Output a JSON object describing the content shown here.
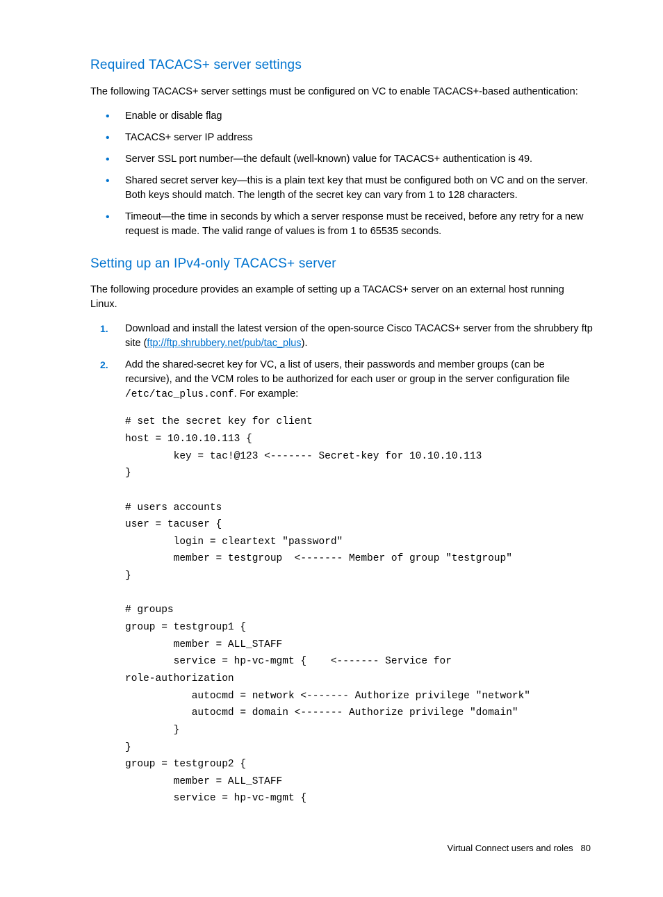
{
  "sections": {
    "required": {
      "title": "Required TACACS+ server settings",
      "intro": "The following TACACS+ server settings must be configured on VC to enable TACACS+-based authentication:",
      "bullets": [
        "Enable or disable flag",
        "TACACS+ server IP address",
        "Server SSL port number—the default (well-known) value for TACACS+ authentication is 49.",
        "Shared secret server key—this is a plain text key that must be configured both on VC and on the server. Both keys should match. The length of the secret key can vary from 1 to 128 characters.",
        "Timeout—the time in seconds by which a server response must be received, before any retry for a new request is made. The valid range of values is from 1 to 65535 seconds."
      ]
    },
    "setup": {
      "title": "Setting up an IPv4-only TACACS+ server",
      "intro": "The following procedure provides an example of setting up a TACACS+ server on an external host running Linux.",
      "step1_pre": "Download and install the latest version of the open-source Cisco TACACS+ server from the shrubbery ftp site (",
      "step1_link": "ftp://ftp.shrubbery.net/pub/tac_plus",
      "step1_post": ").",
      "step2_pre": "Add the shared-secret key for VC, a list of users, their passwords and member groups (can be recursive), and the VCM roles to be authorized for each user or group in the server configuration file ",
      "step2_path": "/etc/tac_plus.conf",
      "step2_post": ". For example:",
      "code": "# set the secret key for client\nhost = 10.10.10.113 {\n        key = tac!@123 <------- Secret-key for 10.10.10.113\n}\n\n# users accounts\nuser = tacuser {\n        login = cleartext \"password\"\n        member = testgroup  <------- Member of group \"testgroup\"\n}\n\n# groups\ngroup = testgroup1 {\n        member = ALL_STAFF\n        service = hp-vc-mgmt {    <------- Service for\nrole-authorization\n           autocmd = network <------- Authorize privilege \"network\"\n           autocmd = domain <------- Authorize privilege \"domain\"\n        }\n}\ngroup = testgroup2 {\n        member = ALL_STAFF\n        service = hp-vc-mgmt {"
    }
  },
  "footer": {
    "section": "Virtual Connect users and roles",
    "page": "80"
  }
}
